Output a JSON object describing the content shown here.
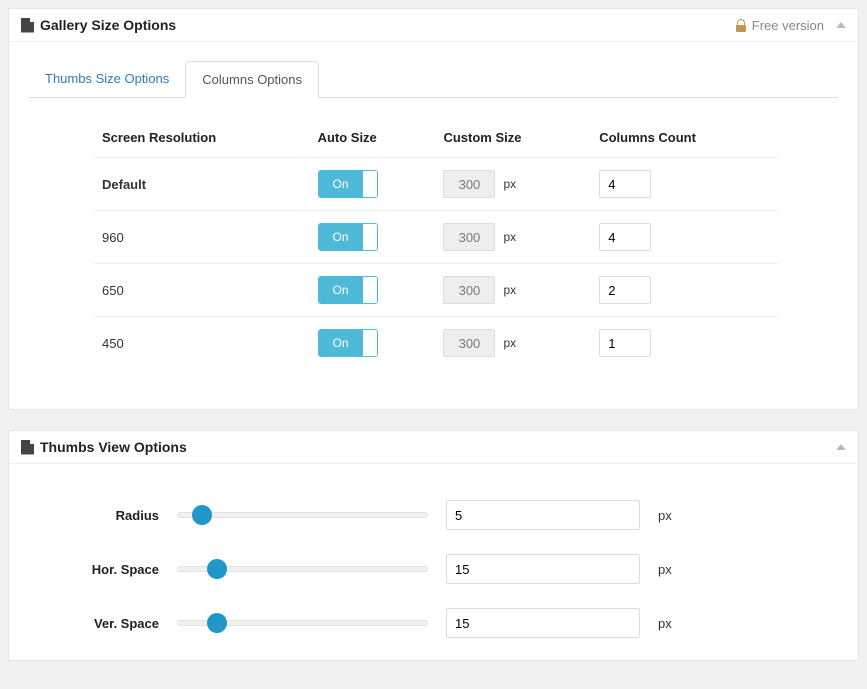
{
  "panel1": {
    "title": "Gallery Size Options",
    "free_version_label": "Free version",
    "tabs": [
      {
        "label": "Thumbs Size Options",
        "active": false
      },
      {
        "label": "Columns Options",
        "active": true
      }
    ],
    "columns": {
      "headers": {
        "resolution": "Screen Resolution",
        "auto": "Auto Size",
        "custom": "Custom Size",
        "count": "Columns Count"
      },
      "toggle_on_label": "On",
      "custom_unit": "px",
      "rows": [
        {
          "resolution": "Default",
          "auto": true,
          "custom": "300",
          "count": "4"
        },
        {
          "resolution": "960",
          "auto": true,
          "custom": "300",
          "count": "4"
        },
        {
          "resolution": "650",
          "auto": true,
          "custom": "300",
          "count": "2"
        },
        {
          "resolution": "450",
          "auto": true,
          "custom": "300",
          "count": "1"
        }
      ]
    }
  },
  "panel2": {
    "title": "Thumbs View Options",
    "sliders": {
      "radius": {
        "label": "Radius",
        "value": "5",
        "unit": "px",
        "pos": 10
      },
      "horspace": {
        "label": "Hor. Space",
        "value": "15",
        "unit": "px",
        "pos": 16
      },
      "verspace": {
        "label": "Ver. Space",
        "value": "15",
        "unit": "px",
        "pos": 16
      }
    }
  }
}
